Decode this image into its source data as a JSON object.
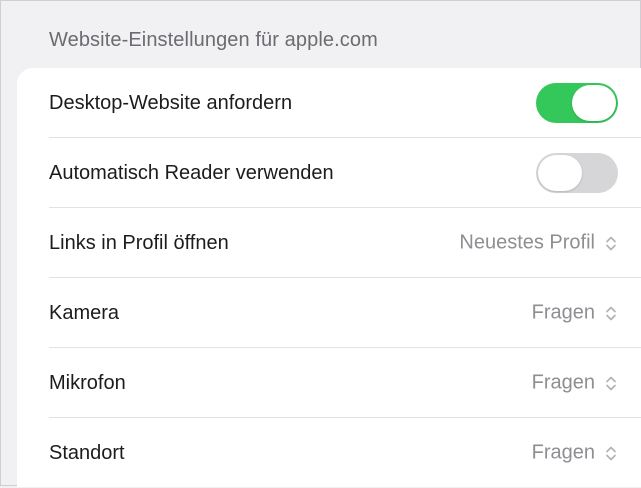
{
  "section": {
    "title": "Website-Einstellungen für apple.com"
  },
  "rows": [
    {
      "label": "Desktop-Website anfordern",
      "type": "toggle",
      "state": "on"
    },
    {
      "label": "Automatisch Reader verwenden",
      "type": "toggle",
      "state": "off"
    },
    {
      "label": "Links in Profil öffnen",
      "type": "select",
      "value": "Neuestes Profil",
      "icon": "chevron-up-down-icon"
    },
    {
      "label": "Kamera",
      "type": "select",
      "value": "Fragen",
      "icon": "chevron-up-down-icon"
    },
    {
      "label": "Mikrofon",
      "type": "select",
      "value": "Fragen",
      "icon": "chevron-up-down-icon"
    },
    {
      "label": "Standort",
      "type": "select",
      "value": "Fragen",
      "icon": "chevron-up-down-icon"
    }
  ],
  "colors": {
    "toggle_on": "#34c759",
    "toggle_off": "#d6d6d9",
    "background": "#f1f1f3",
    "card": "#ffffff"
  }
}
